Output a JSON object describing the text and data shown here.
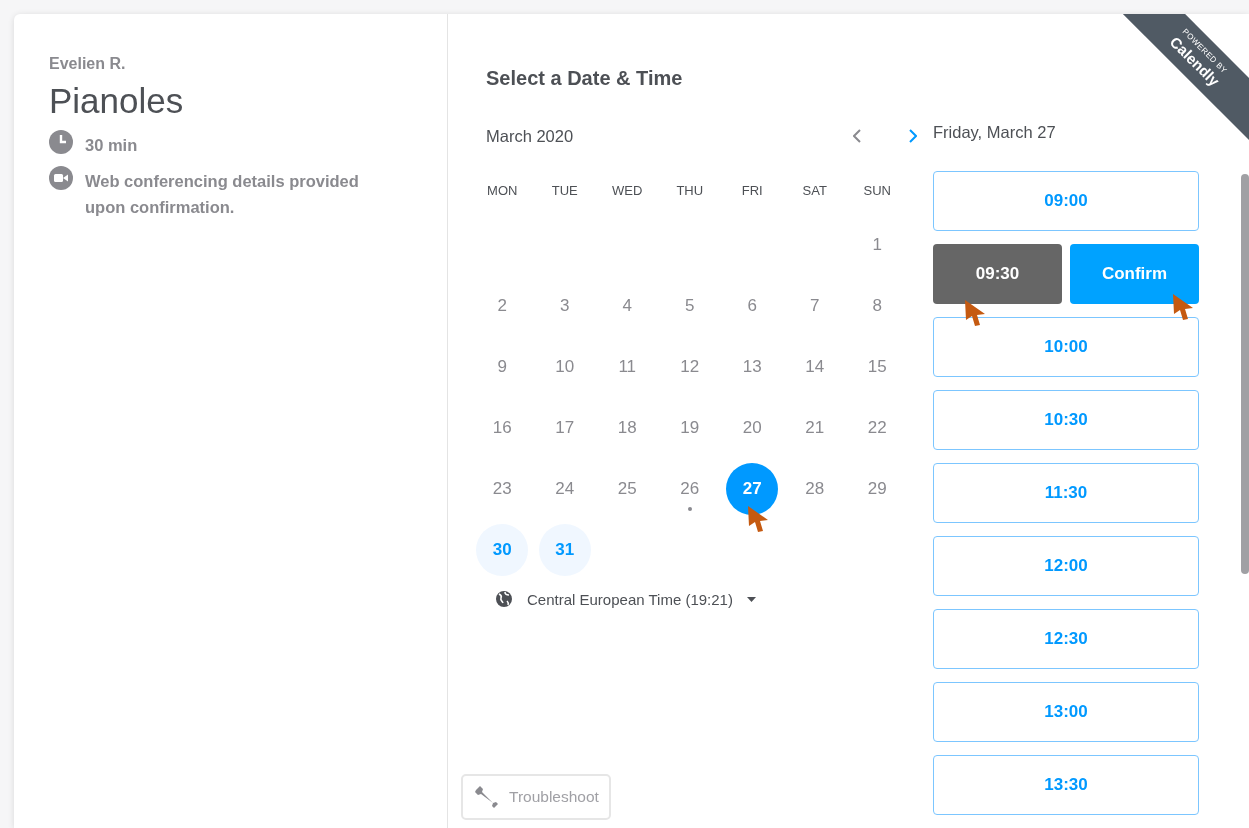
{
  "host": {
    "name": "Evelien R."
  },
  "event": {
    "title": "Pianoles",
    "duration": "30 min",
    "location": "Web conferencing details provided upon confirmation."
  },
  "heading": "Select a Date & Time",
  "calendar": {
    "month": "March 2020",
    "prev": {
      "disabled": true
    },
    "next": {
      "disabled": false
    },
    "weekdays": [
      "MON",
      "TUE",
      "WED",
      "THU",
      "FRI",
      "SAT",
      "SUN"
    ],
    "weeks": [
      [
        {
          "n": "1",
          "available": false,
          "selected": false,
          "today": false,
          "cursor": false
        }
      ],
      [
        {
          "n": "2",
          "available": false,
          "selected": false,
          "today": false,
          "cursor": false
        },
        {
          "n": "3",
          "available": false,
          "selected": false,
          "today": false,
          "cursor": false
        },
        {
          "n": "4",
          "available": false,
          "selected": false,
          "today": false,
          "cursor": false
        },
        {
          "n": "5",
          "available": false,
          "selected": false,
          "today": false,
          "cursor": false
        },
        {
          "n": "6",
          "available": false,
          "selected": false,
          "today": false,
          "cursor": false
        },
        {
          "n": "7",
          "available": false,
          "selected": false,
          "today": false,
          "cursor": false
        },
        {
          "n": "8",
          "available": false,
          "selected": false,
          "today": false,
          "cursor": false
        }
      ],
      [
        {
          "n": "9",
          "available": false,
          "selected": false,
          "today": false,
          "cursor": false
        },
        {
          "n": "10",
          "available": false,
          "selected": false,
          "today": false,
          "cursor": false
        },
        {
          "n": "11",
          "available": false,
          "selected": false,
          "today": false,
          "cursor": false
        },
        {
          "n": "12",
          "available": false,
          "selected": false,
          "today": false,
          "cursor": false
        },
        {
          "n": "13",
          "available": false,
          "selected": false,
          "today": false,
          "cursor": false
        },
        {
          "n": "14",
          "available": false,
          "selected": false,
          "today": false,
          "cursor": false
        },
        {
          "n": "15",
          "available": false,
          "selected": false,
          "today": false,
          "cursor": false
        }
      ],
      [
        {
          "n": "16",
          "available": false,
          "selected": false,
          "today": false,
          "cursor": false
        },
        {
          "n": "17",
          "available": false,
          "selected": false,
          "today": false,
          "cursor": false
        },
        {
          "n": "18",
          "available": false,
          "selected": false,
          "today": false,
          "cursor": false
        },
        {
          "n": "19",
          "available": false,
          "selected": false,
          "today": false,
          "cursor": false
        },
        {
          "n": "20",
          "available": false,
          "selected": false,
          "today": false,
          "cursor": false
        },
        {
          "n": "21",
          "available": false,
          "selected": false,
          "today": false,
          "cursor": false
        },
        {
          "n": "22",
          "available": false,
          "selected": false,
          "today": false,
          "cursor": false
        }
      ],
      [
        {
          "n": "23",
          "available": false,
          "selected": false,
          "today": false,
          "cursor": false
        },
        {
          "n": "24",
          "available": false,
          "selected": false,
          "today": false,
          "cursor": false
        },
        {
          "n": "25",
          "available": false,
          "selected": false,
          "today": false,
          "cursor": false
        },
        {
          "n": "26",
          "available": false,
          "selected": false,
          "today": true,
          "cursor": false
        },
        {
          "n": "27",
          "available": true,
          "selected": true,
          "today": false,
          "cursor": true
        },
        {
          "n": "28",
          "available": false,
          "selected": false,
          "today": false,
          "cursor": false
        },
        {
          "n": "29",
          "available": false,
          "selected": false,
          "today": false,
          "cursor": false
        }
      ],
      [
        {
          "n": "30",
          "available": true,
          "selected": false,
          "today": false,
          "cursor": false
        },
        {
          "n": "31",
          "available": true,
          "selected": false,
          "today": false,
          "cursor": false
        }
      ]
    ],
    "timezone": "Central European Time (19:21)"
  },
  "troubleshoot": "Troubleshoot",
  "day_heading": "Friday, March 27",
  "slots": [
    {
      "time": "09:00",
      "selected": false,
      "cursor": false
    },
    {
      "time": "09:30",
      "selected": true,
      "cursor": true,
      "confirm": {
        "label": "Confirm",
        "cursor": true
      }
    },
    {
      "time": "10:00",
      "selected": false,
      "cursor": false
    },
    {
      "time": "10:30",
      "selected": false,
      "cursor": false
    },
    {
      "time": "11:30",
      "selected": false,
      "cursor": false
    },
    {
      "time": "12:00",
      "selected": false,
      "cursor": false
    },
    {
      "time": "12:30",
      "selected": false,
      "cursor": false
    },
    {
      "time": "13:00",
      "selected": false,
      "cursor": false
    },
    {
      "time": "13:30",
      "selected": false,
      "cursor": false
    }
  ],
  "ribbon": {
    "top": "POWERED BY",
    "brand": "Calendly"
  }
}
